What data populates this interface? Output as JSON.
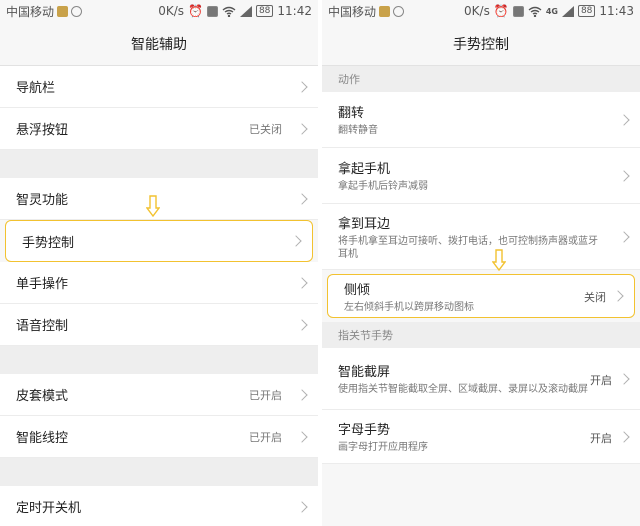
{
  "status_bar": {
    "left": {
      "carrier": "中国移动",
      "carrier_right": "中国移动"
    },
    "right": {
      "speed": "0K/s",
      "battery": "88",
      "time_left": "11:42",
      "time_right": "11:43",
      "net": "4G"
    }
  },
  "left_panel": {
    "title": "智能辅助",
    "groups": [
      [
        {
          "label": "导航栏",
          "status": ""
        },
        {
          "label": "悬浮按钮",
          "status": "已关闭"
        }
      ],
      [
        {
          "label": "智灵功能",
          "status": ""
        },
        {
          "label": "手势控制",
          "status": "",
          "highlighted": true
        },
        {
          "label": "单手操作",
          "status": ""
        },
        {
          "label": "语音控制",
          "status": ""
        }
      ],
      [
        {
          "label": "皮套模式",
          "status": "已开启"
        },
        {
          "label": "智能线控",
          "status": "已开启"
        }
      ],
      [
        {
          "label": "定时开关机",
          "status": ""
        }
      ]
    ]
  },
  "right_panel": {
    "title": "手势控制",
    "sections": [
      {
        "header": "动作",
        "items": [
          {
            "title": "翻转",
            "sub": "翻转静音",
            "status": ""
          },
          {
            "title": "拿起手机",
            "sub": "拿起手机后铃声减弱",
            "status": ""
          },
          {
            "title": "拿到耳边",
            "sub": "将手机拿至耳边可接听、拨打电话，也可控制扬声器或蓝牙耳机",
            "status": ""
          },
          {
            "title": "侧倾",
            "sub": "左右倾斜手机以跨屏移动图标",
            "status": "关闭",
            "highlighted": true
          }
        ]
      },
      {
        "header": "指关节手势",
        "items": [
          {
            "title": "智能截屏",
            "sub": "使用指关节智能截取全屏、区域截屏、录屏以及滚动截屏",
            "status": "开启"
          },
          {
            "title": "字母手势",
            "sub": "画字母打开应用程序",
            "status": "开启"
          }
        ]
      }
    ]
  },
  "colors": {
    "highlight": "#f2c230",
    "arrow": "#f2c230"
  },
  "icons": [
    "notification-icon",
    "alarm-icon",
    "hd-icon",
    "wifi-icon",
    "signal-icon",
    "battery-icon",
    "chevron-right-icon",
    "arrow-down-icon"
  ]
}
